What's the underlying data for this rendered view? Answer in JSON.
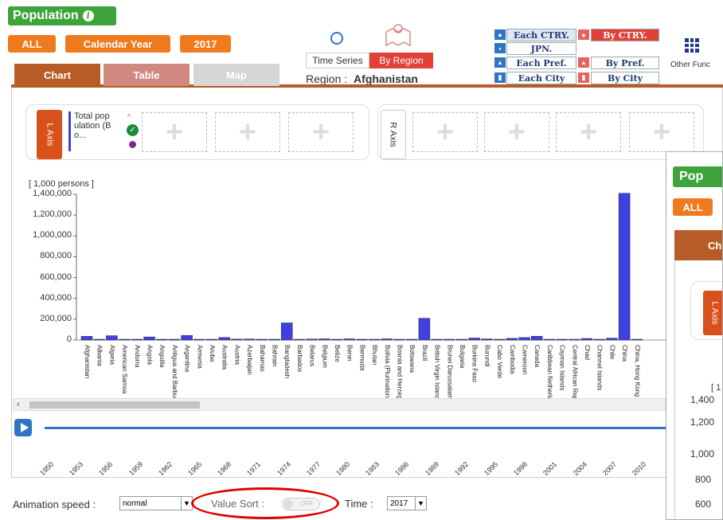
{
  "header": {
    "title": "Population",
    "filter_all": "ALL",
    "filter_calendar": "Calendar Year",
    "filter_year": "2017",
    "time_series_label": "Time Series",
    "by_region_label": "By Region",
    "region_label": "Region :",
    "region_value": "Afghanistan",
    "other_func_label": "Other Func"
  },
  "geo_menu": {
    "each_ctry": "Each CTRY.",
    "by_ctry": "By CTRY.",
    "jpn": "JPN.",
    "each_pref": "Each Pref.",
    "by_pref": "By Pref.",
    "each_city": "Each City",
    "by_city": "By City"
  },
  "tabs": {
    "chart": "Chart",
    "table": "Table",
    "map": "Map"
  },
  "axis_panel": {
    "l_axis": "L Axis",
    "r_axis": "R Axis",
    "series_chip_line1": "Total pop",
    "series_chip_line2": "ulation (B",
    "series_chip_line3": "o...",
    "add_symbol": "+"
  },
  "chart_data": {
    "type": "bar",
    "ylabel": "[ 1,000 persons ]",
    "ylim": [
      0,
      1400000
    ],
    "yticks": [
      "1,400,000",
      "1,200,000",
      "1,000,000",
      "800,000",
      "600,000",
      "400,000",
      "200,000",
      "0"
    ],
    "categories": [
      "Afghanistan",
      "Albania",
      "Algeria",
      "American Samoa",
      "Andorra",
      "Angola",
      "Anguilla",
      "Antigua and Barbuda",
      "Argentina",
      "Armenia",
      "Aruba",
      "Australia",
      "Austria",
      "Azerbaijan",
      "Bahamas",
      "Bahrain",
      "Bangladesh",
      "Barbados",
      "Belarus",
      "Belgium",
      "Belize",
      "Benin",
      "Bermuda",
      "Bhutan",
      "Bolivia (Plurinational",
      "Bosnia and Herzeg.",
      "Botswana",
      "Brazil",
      "British Virgin Islands",
      "Brunei Darussalam",
      "Bulgaria",
      "Burkina Faso",
      "Burundi",
      "Cabo Verde",
      "Cambodia",
      "Cameroon",
      "Canada",
      "Caribbean Netherla.",
      "Cayman Islands",
      "Central African Rep.",
      "Chad",
      "Channel Islands",
      "Chile",
      "China",
      "China, Hong Kong"
    ],
    "values": [
      35500,
      2900,
      41300,
      60,
      80,
      29800,
      15,
      100,
      44300,
      2900,
      100,
      24500,
      8700,
      9800,
      400,
      1500,
      164700,
      300,
      9500,
      11400,
      400,
      11200,
      60,
      800,
      11100,
      3500,
      2300,
      209300,
      30,
      430,
      7100,
      19200,
      10900,
      550,
      16000,
      24100,
      36600,
      25,
      60,
      4700,
      14900,
      170,
      18100,
      1409500,
      7400
    ]
  },
  "timeline": {
    "years": [
      "1950",
      "1953",
      "1956",
      "1959",
      "1962",
      "1965",
      "1968",
      "1971",
      "1974",
      "1977",
      "1980",
      "1983",
      "1986",
      "1989",
      "1992",
      "1995",
      "1998",
      "2001",
      "2004",
      "2007",
      "2010"
    ]
  },
  "controls": {
    "animation_speed_label": "Animation speed :",
    "animation_speed_value": "normal",
    "value_sort_label": "Value Sort :",
    "value_sort_state": "OFF",
    "time_label": "Time :",
    "time_value": "2017"
  },
  "overlay": {
    "title": "Pop",
    "all": "ALL",
    "tab_label": "Ch",
    "l_axis": "L Axis",
    "y_tick_1400": "1,400",
    "y_tick_1200": "1,200",
    "y_tick_1000": "1,000",
    "y_tick_800": "800",
    "y_tick_600": "600",
    "unit_fragment": "[ 1"
  },
  "colors": {
    "bar": "#4040e0",
    "brand_green": "#3ea33a",
    "orange": "#f07a1e",
    "tab_brown": "#b75b27",
    "annotation_red": "#e00000"
  }
}
